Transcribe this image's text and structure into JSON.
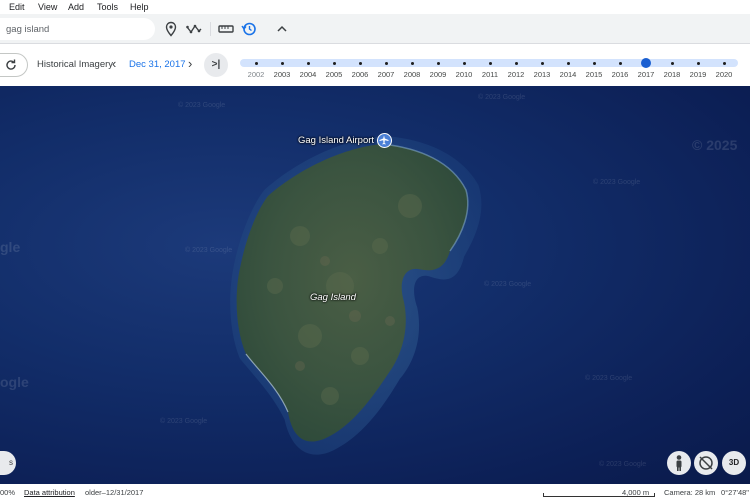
{
  "menu": [
    "Edit",
    "View",
    "Add",
    "Tools",
    "Help"
  ],
  "search": {
    "value": "gag island"
  },
  "toolbar": {
    "icons": [
      "place-marker-icon",
      "path-icon",
      "ruler-icon",
      "historical-imagery-icon",
      "collapse-chevron-icon"
    ]
  },
  "history": {
    "title": "Historical Imagery",
    "date": "Dec 31, 2017",
    "prev_icon": "‹",
    "next_icon": "›",
    "latest_icon": ">|",
    "years": [
      "2002",
      "2003",
      "2004",
      "2005",
      "2006",
      "2007",
      "2008",
      "2009",
      "2010",
      "2011",
      "2012",
      "2013",
      "2014",
      "2015",
      "2016",
      "2017",
      "2018",
      "2019",
      "2020"
    ],
    "selected_year": "2017"
  },
  "map": {
    "airport_label": "Gag Island Airport",
    "island_label": "Gag Island",
    "watermark": "© 2023 Google",
    "watermark_big": "© 2025",
    "edge_text": "gle",
    "edge_text_2": "ogle",
    "btn_left_label": "s",
    "btn_3d_label": "3D"
  },
  "status": {
    "zoom": "00%",
    "attribution": "Data attribution",
    "imagery_date": "older–12/31/2017",
    "scale": "4,000 m",
    "camera": "Camera: 28 km",
    "coords": "0°27'48\""
  },
  "colors": {
    "accent": "#1a73e8",
    "timeline": "#d3e3fd",
    "ocean": "#122d69",
    "land": "#3a5a3e"
  }
}
